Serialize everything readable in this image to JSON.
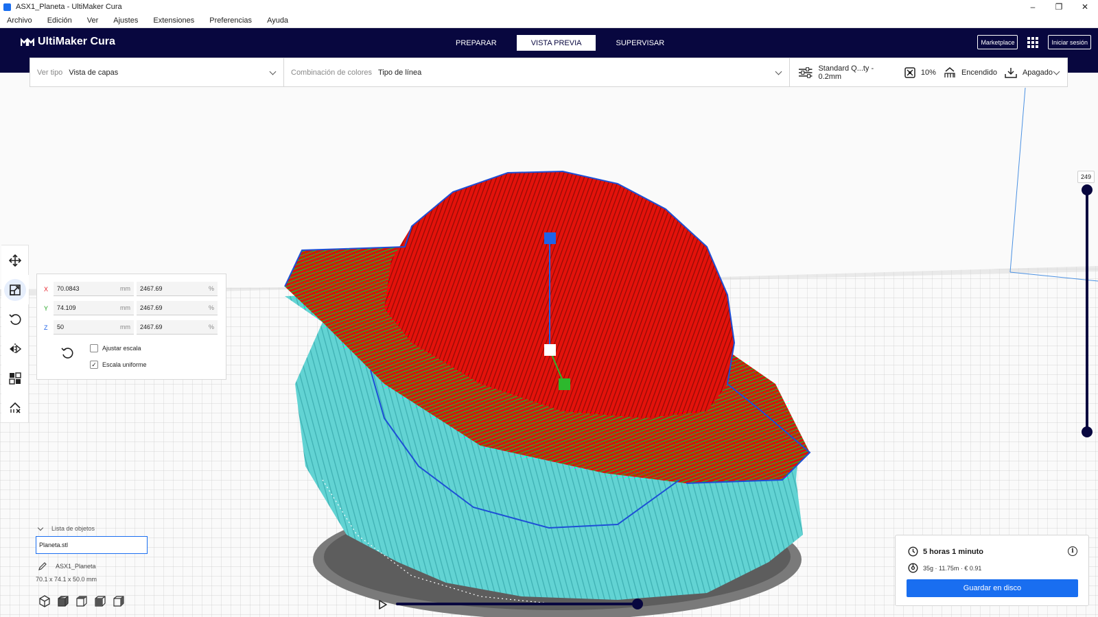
{
  "window": {
    "title": "ASX1_Planeta - UltiMaker Cura",
    "minimize": "–",
    "maximize": "❐",
    "close": "✕"
  },
  "menu": [
    "Archivo",
    "Edición",
    "Ver",
    "Ajustes",
    "Extensiones",
    "Preferencias",
    "Ayuda"
  ],
  "header": {
    "brand": "UltiMaker Cura",
    "stages": [
      "PREPARAR",
      "VISTA PREVIA",
      "SUPERVISAR"
    ],
    "active_stage": "VISTA PREVIA",
    "marketplace": "Marketplace",
    "signin": "Iniciar sesión"
  },
  "toolbar": {
    "view_type_label": "Ver tipo",
    "view_type_value": "Vista de capas",
    "color_scheme_label": "Combinación de colores",
    "color_scheme_value": "Tipo de línea",
    "profile": "Standard Q...ty - 0.2mm",
    "infill": "10%",
    "support": "Encendido",
    "adhesion": "Apagado"
  },
  "scale_panel": {
    "rows": [
      {
        "axis": "X",
        "mm": "70.0843",
        "mm_unit": "mm",
        "pct": "2467.69",
        "pct_unit": "%",
        "color": "#e8222a"
      },
      {
        "axis": "Y",
        "mm": "74.109",
        "mm_unit": "mm",
        "pct": "2467.69",
        "pct_unit": "%",
        "color": "#1fa31f"
      },
      {
        "axis": "Z",
        "mm": "50",
        "mm_unit": "mm",
        "pct": "2467.69",
        "pct_unit": "%",
        "color": "#1e63e8"
      }
    ],
    "snap_label": "Ajustar escala",
    "snap_checked": false,
    "uniform_label": "Escala uniforme",
    "uniform_checked": true
  },
  "object_list": {
    "header": "Lista de objetos",
    "file": "Planeta.stl",
    "object_name": "ASX1_Planeta",
    "dimensions": "70.1 x 74.1 x 50.0 mm"
  },
  "layer_slider": {
    "current_layer": "249",
    "max_fraction": 1.0
  },
  "playback": {
    "progress": 1.0
  },
  "estimate": {
    "time": "5 horas 1 minuto",
    "material": "35g · 11.75m · € 0.91",
    "save_label": "Guardar en disco",
    "info": "i"
  },
  "colors": {
    "header_bg": "#08073f",
    "accent": "#196ef0",
    "wall_outer": "#e8140c",
    "wall_inner": "#2db82d",
    "support": "#5fd2d2",
    "skirt": "#6f6f6f"
  }
}
